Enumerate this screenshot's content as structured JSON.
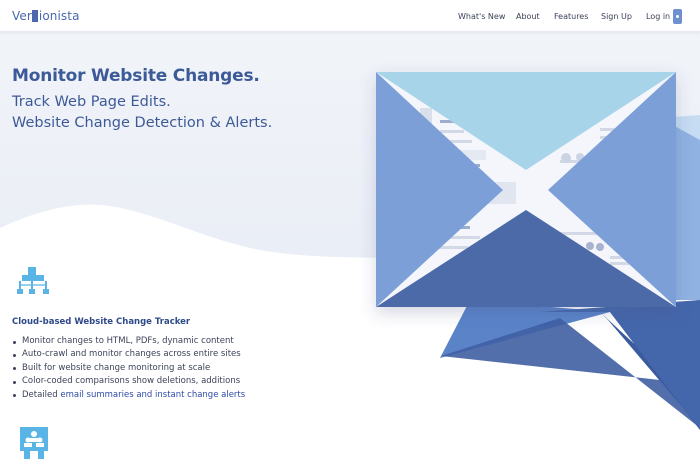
{
  "header": {
    "logo_text": "Versionista",
    "nav": [
      "What's New",
      "About",
      "Features",
      "Sign Up",
      "Log in"
    ]
  },
  "hero": {
    "headline": "Monitor Website Changes.",
    "sub_line_1": "Track Web Page Edits.",
    "sub_line_2": "Website Change Detection & Alerts."
  },
  "feature": {
    "title": "Cloud-based Website Change Tracker",
    "items": [
      "Monitor changes to HTML, PDFs, dynamic content",
      "Auto-crawl and monitor changes across entire sites",
      "Built for website change monitoring at scale",
      "Color-coded comparisons show deletions, additions"
    ],
    "last_item_prefix": "Detailed ",
    "last_item_link": "email summaries and instant change alerts"
  },
  "icons": {
    "feature_icon": "sitemap-icon",
    "team_icon": "team-icon",
    "illustration": "envelope-illustration"
  },
  "colors": {
    "brand": "#4a67b0",
    "headline": "#3d5a98",
    "envelope_top": "#a8d4ea",
    "envelope_side": "#7b9fd6",
    "envelope_bottom": "#4c6aa8",
    "envelope_dark": "#3c5a9c",
    "link": "#2f4aa8",
    "icon_blue": "#5ab4e6"
  }
}
